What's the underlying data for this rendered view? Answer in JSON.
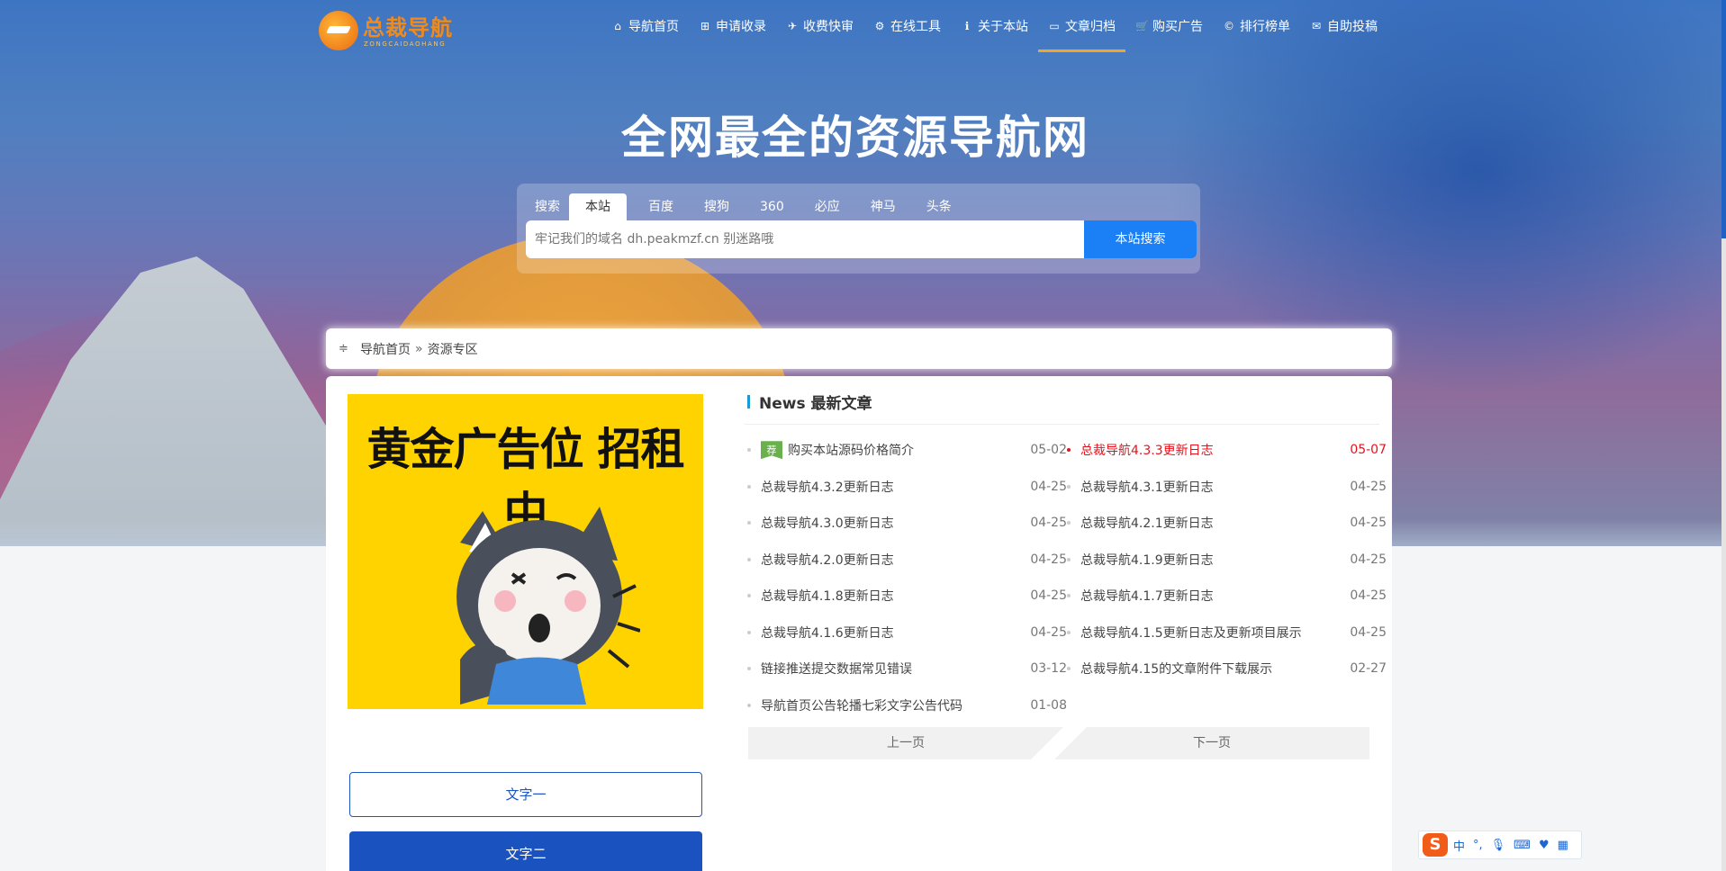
{
  "site": {
    "logo_text": "总裁导航",
    "logo_sub": "ZONGCAIDAOHANG",
    "headline": "全网最全的资源导航网"
  },
  "nav": [
    {
      "label": "导航首页",
      "icon": "home-icon",
      "glyph": "⌂"
    },
    {
      "label": "申请收录",
      "icon": "plus-square-icon",
      "glyph": "⊞"
    },
    {
      "label": "收费快审",
      "icon": "rocket-icon",
      "glyph": "✈"
    },
    {
      "label": "在线工具",
      "icon": "gears-icon",
      "glyph": "⚙"
    },
    {
      "label": "关于本站",
      "icon": "info-icon",
      "glyph": "ℹ"
    },
    {
      "label": "文章归档",
      "icon": "folder-open-icon",
      "glyph": "▭",
      "active": true
    },
    {
      "label": "购买广告",
      "icon": "cart-icon",
      "glyph": "🛒"
    },
    {
      "label": "排行榜单",
      "icon": "copyright-icon",
      "glyph": "©"
    },
    {
      "label": "自助投稿",
      "icon": "inbox-icon",
      "glyph": "✉"
    }
  ],
  "search": {
    "tabs": [
      "搜索",
      "本站",
      "百度",
      "搜狗",
      "360",
      "必应",
      "神马",
      "头条"
    ],
    "active_tab": "本站",
    "placeholder": "牢记我们的域名 dh.peakmzf.cn 别迷路哦",
    "button": "本站搜索"
  },
  "breadcrumb": {
    "home": "导航首页",
    "sep": "»",
    "current": "资源专区"
  },
  "ad": {
    "text": "黄金广告位 招租中"
  },
  "buttons": {
    "text1": "文字一",
    "text2": "文字二"
  },
  "news": {
    "title": "News 最新文章",
    "left": [
      {
        "title": "购买本站源码价格简介",
        "date": "05-02",
        "tag": "荐"
      },
      {
        "title": "总裁导航4.3.2更新日志",
        "date": "04-25"
      },
      {
        "title": "总裁导航4.3.0更新日志",
        "date": "04-25"
      },
      {
        "title": "总裁导航4.2.0更新日志",
        "date": "04-25"
      },
      {
        "title": "总裁导航4.1.8更新日志",
        "date": "04-25"
      },
      {
        "title": "总裁导航4.1.6更新日志",
        "date": "04-25"
      },
      {
        "title": "链接推送提交数据常见错误",
        "date": "03-12"
      },
      {
        "title": "导航首页公告轮播七彩文字公告代码",
        "date": "01-08"
      }
    ],
    "right": [
      {
        "title": "总裁导航4.3.3更新日志",
        "date": "05-07",
        "hot": true
      },
      {
        "title": "总裁导航4.3.1更新日志",
        "date": "04-25"
      },
      {
        "title": "总裁导航4.2.1更新日志",
        "date": "04-25"
      },
      {
        "title": "总裁导航4.1.9更新日志",
        "date": "04-25"
      },
      {
        "title": "总裁导航4.1.7更新日志",
        "date": "04-25"
      },
      {
        "title": "总裁导航4.1.5更新日志及更新项目展示",
        "date": "04-25"
      },
      {
        "title": "总裁导航4.15的文章附件下载展示",
        "date": "02-27"
      }
    ],
    "prev": "上一页",
    "next": "下一页"
  },
  "ime": {
    "logo": "S",
    "lang": "中",
    "punct": "°,",
    "mic": "🎙",
    "kbd": "⌨",
    "skin": "♥",
    "grid": "▦"
  },
  "colors": {
    "accent": "#1b7ff5",
    "nav_active": "#f4a428",
    "hot": "#e8111b",
    "tag": "#6ab04c",
    "ad_bg": "#ffd300"
  }
}
